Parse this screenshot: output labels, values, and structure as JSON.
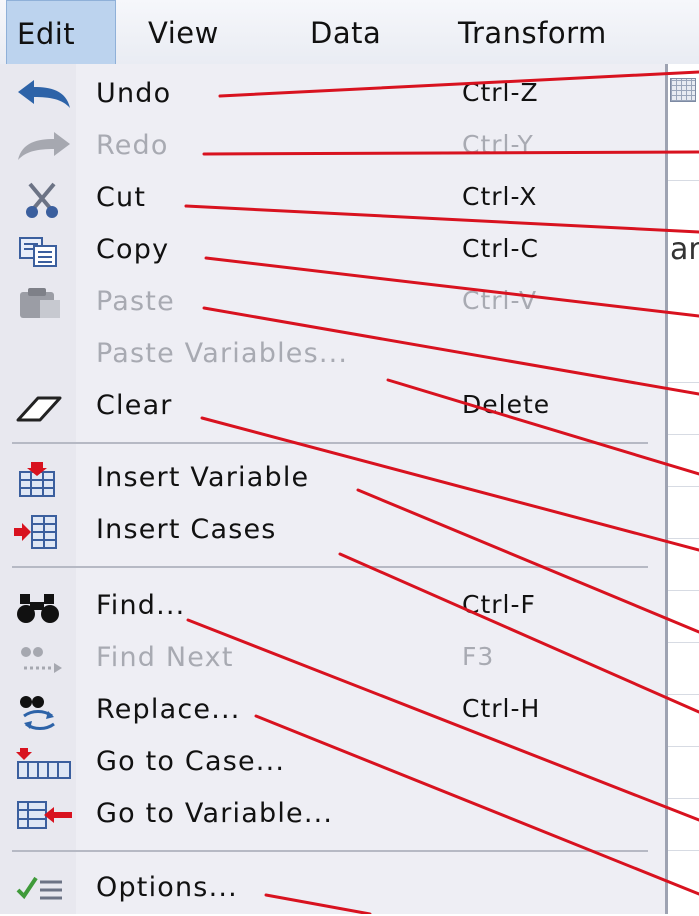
{
  "menubar": {
    "edit": "Edit",
    "view": "View",
    "data": "Data",
    "transform": "Transform"
  },
  "background": {
    "fragment": "ar"
  },
  "menu": {
    "undo": {
      "label": "Undo",
      "shortcut": "Ctrl-Z"
    },
    "redo": {
      "label": "Redo",
      "shortcut": "Ctrl-Y"
    },
    "cut": {
      "label": "Cut",
      "shortcut": "Ctrl-X"
    },
    "copy": {
      "label": "Copy",
      "shortcut": "Ctrl-C"
    },
    "paste": {
      "label": "Paste",
      "shortcut": "Ctrl-V"
    },
    "paste_variables": {
      "label": "Paste Variables..."
    },
    "clear": {
      "label": "Clear",
      "shortcut": "Delete"
    },
    "insert_variable": {
      "label": "Insert Variable"
    },
    "insert_cases": {
      "label": "Insert Cases"
    },
    "find": {
      "label": "Find...",
      "shortcut": "Ctrl-F"
    },
    "find_next": {
      "label": "Find Next",
      "shortcut": "F3"
    },
    "replace": {
      "label": "Replace...",
      "shortcut": "Ctrl-H"
    },
    "go_to_case": {
      "label": "Go to Case..."
    },
    "go_to_variable": {
      "label": "Go to Variable..."
    },
    "options": {
      "label": "Options..."
    }
  },
  "colors": {
    "annotation_line": "#d8121f",
    "active_menu_bg": "#bcd3ee",
    "disabled_text": "#a8aab2"
  }
}
